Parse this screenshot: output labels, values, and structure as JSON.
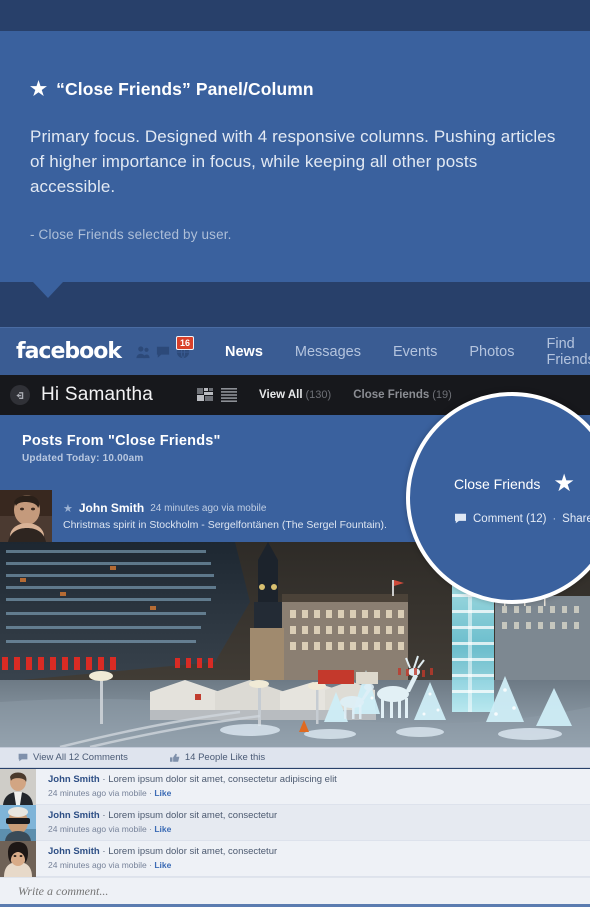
{
  "callout": {
    "star_icon": "star-icon",
    "title": "“Close Friends” Panel/Column",
    "body": "Primary focus. Designed with 4 responsive columns. Pushing articles of higher importance in focus, while keeping all other posts accessible.",
    "note": "- Close Friends selected by user."
  },
  "fbnav": {
    "logo": "facebook",
    "icons": [
      {
        "name": "friends-icon"
      },
      {
        "name": "messages-icon"
      },
      {
        "name": "globe-notifications-icon"
      }
    ],
    "notification_count": "16",
    "tabs": [
      {
        "label": "News",
        "active": true
      },
      {
        "label": "Messages",
        "active": false
      },
      {
        "label": "Events",
        "active": false
      },
      {
        "label": "Photos",
        "active": false
      },
      {
        "label": "Find Friends",
        "active": false
      }
    ]
  },
  "userbar": {
    "signin_icon": "sign-in-arrow-icon",
    "greeting": "Hi Samantha",
    "grid_view_icon": "grid-view-icon",
    "list_view_icon": "list-view-icon",
    "filters": [
      {
        "label": "View All",
        "count": "(130)",
        "active": true
      },
      {
        "label": "Close Friends",
        "count": "(19)",
        "active": false
      }
    ]
  },
  "post": {
    "header_title": "Posts From \"Close Friends\"",
    "header_sub": "Updated Today: 10.00am",
    "star_icon": "star-icon",
    "author": "John Smith",
    "time": "24 minutes ago via mobile",
    "caption": "Christmas spirit in Stockholm - Sergelfontänen (The Sergel Fountain).",
    "actions": {
      "comments_icon": "comment-bubble-icon",
      "comments_label": "View All 12 Comments",
      "likes_icon": "thumbs-up-icon",
      "likes_label": "14 People Like this"
    },
    "comments": [
      {
        "name": "John Smith",
        "sep": "·",
        "text": "Lorem ipsum dolor sit amet, consectetur adipiscing elit",
        "meta": "24 minutes ago via mobile ·",
        "like": "Like"
      },
      {
        "name": "John Smith",
        "sep": "·",
        "text": "Lorem ipsum dolor sit amet, consectetur",
        "meta": "24 minutes ago via mobile ·",
        "like": "Like"
      },
      {
        "name": "John Smith",
        "sep": "·",
        "text": "Lorem ipsum dolor sit amet, consectetur",
        "meta": "24 minutes ago via mobile ·",
        "like": "Like"
      }
    ],
    "write_comment_placeholder": "Write a comment..."
  },
  "circle": {
    "title": "Close Friends",
    "star_icon": "star-icon",
    "comment_icon": "comment-bubble-icon",
    "comment_label": "Comment (12)",
    "separator": "·",
    "share_label": "Share"
  },
  "colors": {
    "panel_blue": "#3a619e",
    "nav_blue": "#3a5c93",
    "dark_bar": "#17181c",
    "badge_red": "#d9402a",
    "page_bg": "#28406a",
    "comment_bg": "#eef1f6"
  }
}
